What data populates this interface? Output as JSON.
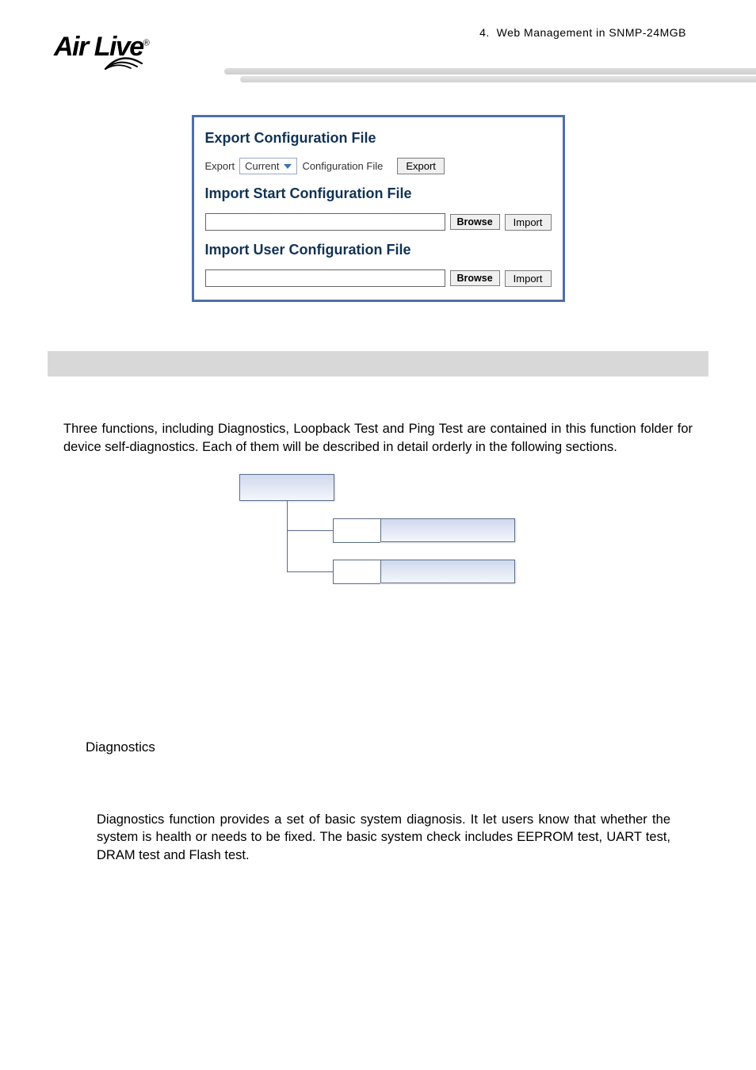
{
  "header": {
    "breadcrumb_index": "4.",
    "breadcrumb_text": "Web Management in SNMP-24MGB",
    "logo_text_a": "Air",
    "logo_text_b": "Live"
  },
  "config_panel": {
    "h1": "Export Configuration File",
    "export_prefix": "Export",
    "export_select_value": "Current",
    "export_suffix": "Configuration File",
    "export_btn": "Export",
    "h2": "Import Start Configuration File",
    "browse_btn": "Browse",
    "import_btn": "Import",
    "h3": "Import User Configuration File",
    "file1_value": "",
    "file2_value": ""
  },
  "section": {
    "intro": "Three functions, including Diagnostics, Loopback Test and Ping Test are contained in this function folder for device self-diagnostics. Each of them will be described in detail orderly in the following sections."
  },
  "subsection": {
    "title": "Diagnostics",
    "body": "Diagnostics function provides a set of basic system diagnosis. It let users know that whether the system is health or needs to be fixed. The basic system check includes EEPROM test, UART test, DRAM test and Flash test."
  }
}
